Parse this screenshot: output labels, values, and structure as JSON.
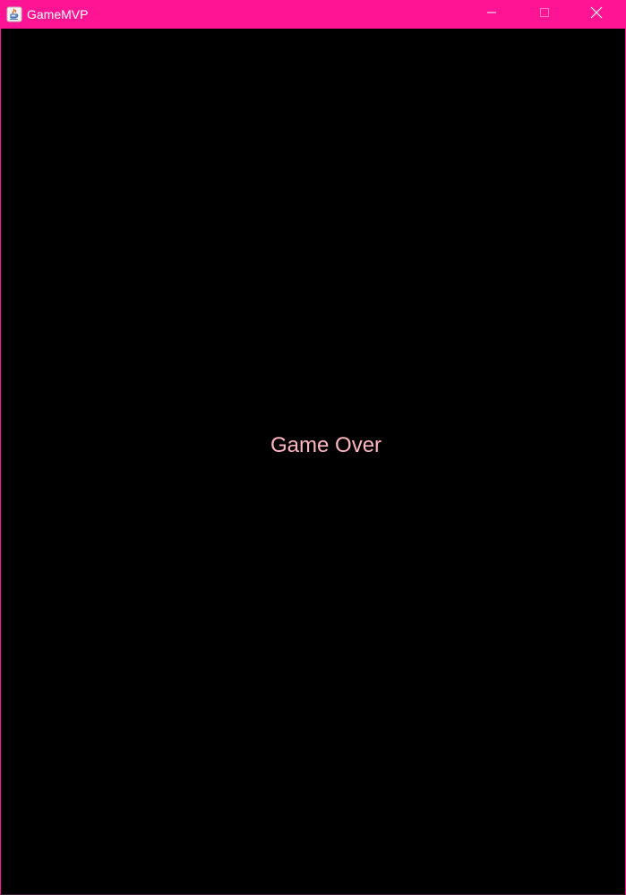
{
  "window": {
    "title": "GameMVP",
    "accent_color": "#ff1493"
  },
  "titlebar_controls": {
    "minimize_icon": "minimize-icon",
    "maximize_icon": "maximize-icon",
    "maximize_enabled": false,
    "close_icon": "close-icon"
  },
  "app_icon": "java-app-icon",
  "game": {
    "background_color": "#000000",
    "message": "Game Over",
    "message_color": "#ffb6c1"
  }
}
